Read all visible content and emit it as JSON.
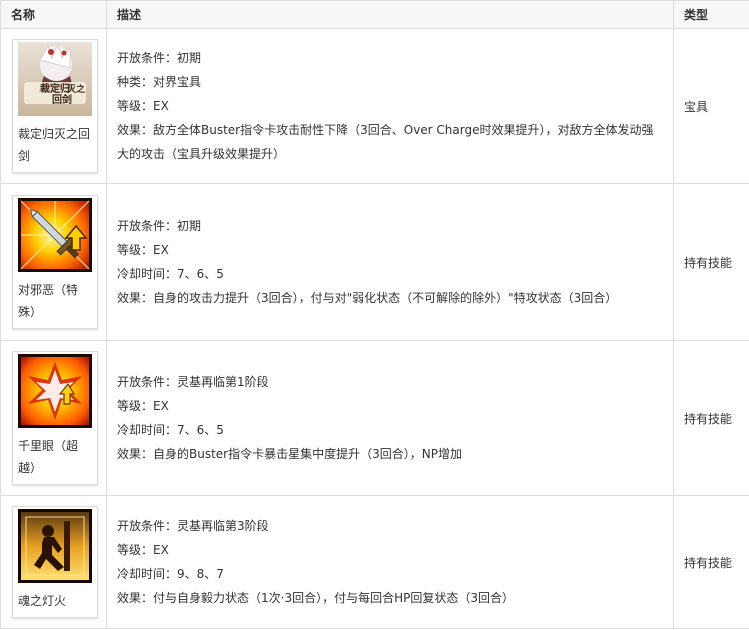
{
  "header": {
    "name": "名称",
    "desc": "描述",
    "type": "类型"
  },
  "rows": [
    {
      "icon": "noble-phantasm-card-icon",
      "thumb_text_top": "裁定归",
      "thumb_text_bottom": "灭之",
      "thumb_text_3": "回剑",
      "name": "裁定归灭之回剑",
      "lines": [
        "开放条件：初期",
        "种类：对界宝具",
        "等级：EX",
        "效果：敌方全体Buster指令卡攻击耐性下降（3回合、Over Charge时效果提升），对敌方全体发动强大的攻击（宝具升级效果提升）"
      ],
      "type": "宝具"
    },
    {
      "icon": "sword-up-icon",
      "name": "对邪恶（特殊）",
      "lines": [
        "开放条件：初期",
        "等级：EX",
        "冷却时间：7、6、5",
        "效果：自身的攻击力提升（3回合），付与对\"弱化状态（不可解除的除外）\"特攻状态（3回合）"
      ],
      "type": "持有技能"
    },
    {
      "icon": "critical-star-burst-icon",
      "name": "千里眼（超越）",
      "lines": [
        "开放条件：灵基再临第1阶段",
        "等级：EX",
        "冷却时间：7、6、5",
        "效果：自身的Buster指令卡暴击星集中度提升（3回合），NP增加"
      ],
      "type": "持有技能"
    },
    {
      "icon": "guts-kneeling-icon",
      "name": "魂之灯火",
      "lines": [
        "开放条件：灵基再临第3阶段",
        "等级：EX",
        "冷却时间：9、8、7",
        "效果：付与自身毅力状态（1次·3回合），付与每回合HP回复状态（3回合）"
      ],
      "type": "持有技能"
    }
  ],
  "colors": {
    "header_bg": "#f7f7f7",
    "border": "#dddddd",
    "text": "#333333"
  }
}
